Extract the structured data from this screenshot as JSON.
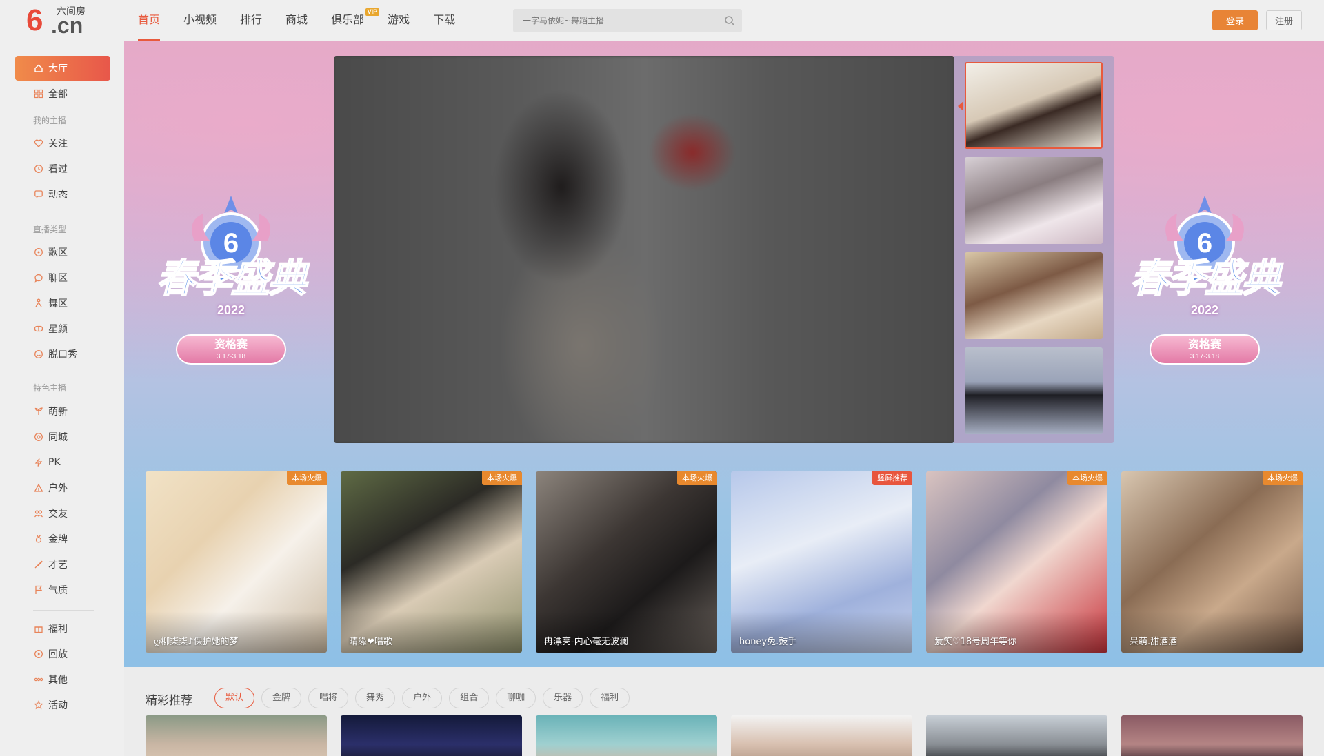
{
  "header": {
    "logo": {
      "brand_sub": "六间房",
      "brand_mark": "6",
      "brand_domain": ".cn"
    },
    "nav": [
      {
        "label": "首页",
        "active": true
      },
      {
        "label": "小视频"
      },
      {
        "label": "排行"
      },
      {
        "label": "商城"
      },
      {
        "label": "俱乐部",
        "badge": "VIP"
      },
      {
        "label": "游戏"
      },
      {
        "label": "下载"
      }
    ],
    "search": {
      "placeholder": "一字马依妮~舞蹈主播"
    },
    "login_label": "登录",
    "register_label": "注册",
    "accent_color": "#e85a3d"
  },
  "sidebar": {
    "top_items": [
      {
        "label": "大厅",
        "icon": "home-icon",
        "active": true
      },
      {
        "label": "全部",
        "icon": "grid-icon"
      }
    ],
    "section_my": "我的主播",
    "my_items": [
      {
        "label": "关注",
        "icon": "heart-icon"
      },
      {
        "label": "看过",
        "icon": "clock-icon"
      },
      {
        "label": "动态",
        "icon": "message-icon"
      }
    ],
    "section_type": "直播类型",
    "type_items": [
      {
        "label": "歌区",
        "icon": "music-icon"
      },
      {
        "label": "聊区",
        "icon": "chat-icon"
      },
      {
        "label": "舞区",
        "icon": "dance-icon"
      },
      {
        "label": "星颜",
        "icon": "mask-icon"
      },
      {
        "label": "脱口秀",
        "icon": "talk-icon"
      }
    ],
    "section_special": "特色主播",
    "special_items": [
      {
        "label": "萌新",
        "icon": "sprout-icon"
      },
      {
        "label": "同城",
        "icon": "location-icon"
      },
      {
        "label": "PK",
        "icon": "lightning-icon"
      },
      {
        "label": "户外",
        "icon": "tent-icon"
      },
      {
        "label": "交友",
        "icon": "people-icon"
      },
      {
        "label": "金牌",
        "icon": "medal-icon"
      },
      {
        "label": "才艺",
        "icon": "brush-icon"
      },
      {
        "label": "气质",
        "icon": "flag-icon"
      }
    ],
    "bottom_items": [
      {
        "label": "福利",
        "icon": "gift-icon"
      },
      {
        "label": "回放",
        "icon": "replay-icon"
      },
      {
        "label": "其他",
        "icon": "more-icon"
      },
      {
        "label": "活动",
        "icon": "star-icon"
      }
    ]
  },
  "banner": {
    "event_title": "春季盛典",
    "event_year": "2022",
    "event_stage": "资格赛",
    "event_dates": "3.17-3.18"
  },
  "featured_cards": [
    {
      "name": "ღ柳柒柒♪保护她的梦",
      "tag": "本场火爆",
      "tag_color": "#e8892e"
    },
    {
      "name": "晴缘❤唱歌",
      "tag": "本场火爆",
      "tag_color": "#e8892e"
    },
    {
      "name": "冉漂亮-内心毫无波澜",
      "tag": "本场火爆",
      "tag_color": "#e8892e"
    },
    {
      "name": "honey兔.鼓手",
      "tag": "竖屏推荐",
      "tag_color": "#e8553d"
    },
    {
      "name": "爱笑♡18号周年等你",
      "tag": "本场火爆",
      "tag_color": "#e8892e"
    },
    {
      "name": "呆萌.甜酒酒",
      "tag": "本场火爆",
      "tag_color": "#e8892e"
    }
  ],
  "recommend": {
    "title": "精彩推荐",
    "filters": [
      {
        "label": "默认",
        "active": true
      },
      {
        "label": "金牌"
      },
      {
        "label": "唱将"
      },
      {
        "label": "舞秀"
      },
      {
        "label": "户外"
      },
      {
        "label": "组合"
      },
      {
        "label": "聊咖"
      },
      {
        "label": "乐器"
      },
      {
        "label": "福利"
      }
    ]
  }
}
